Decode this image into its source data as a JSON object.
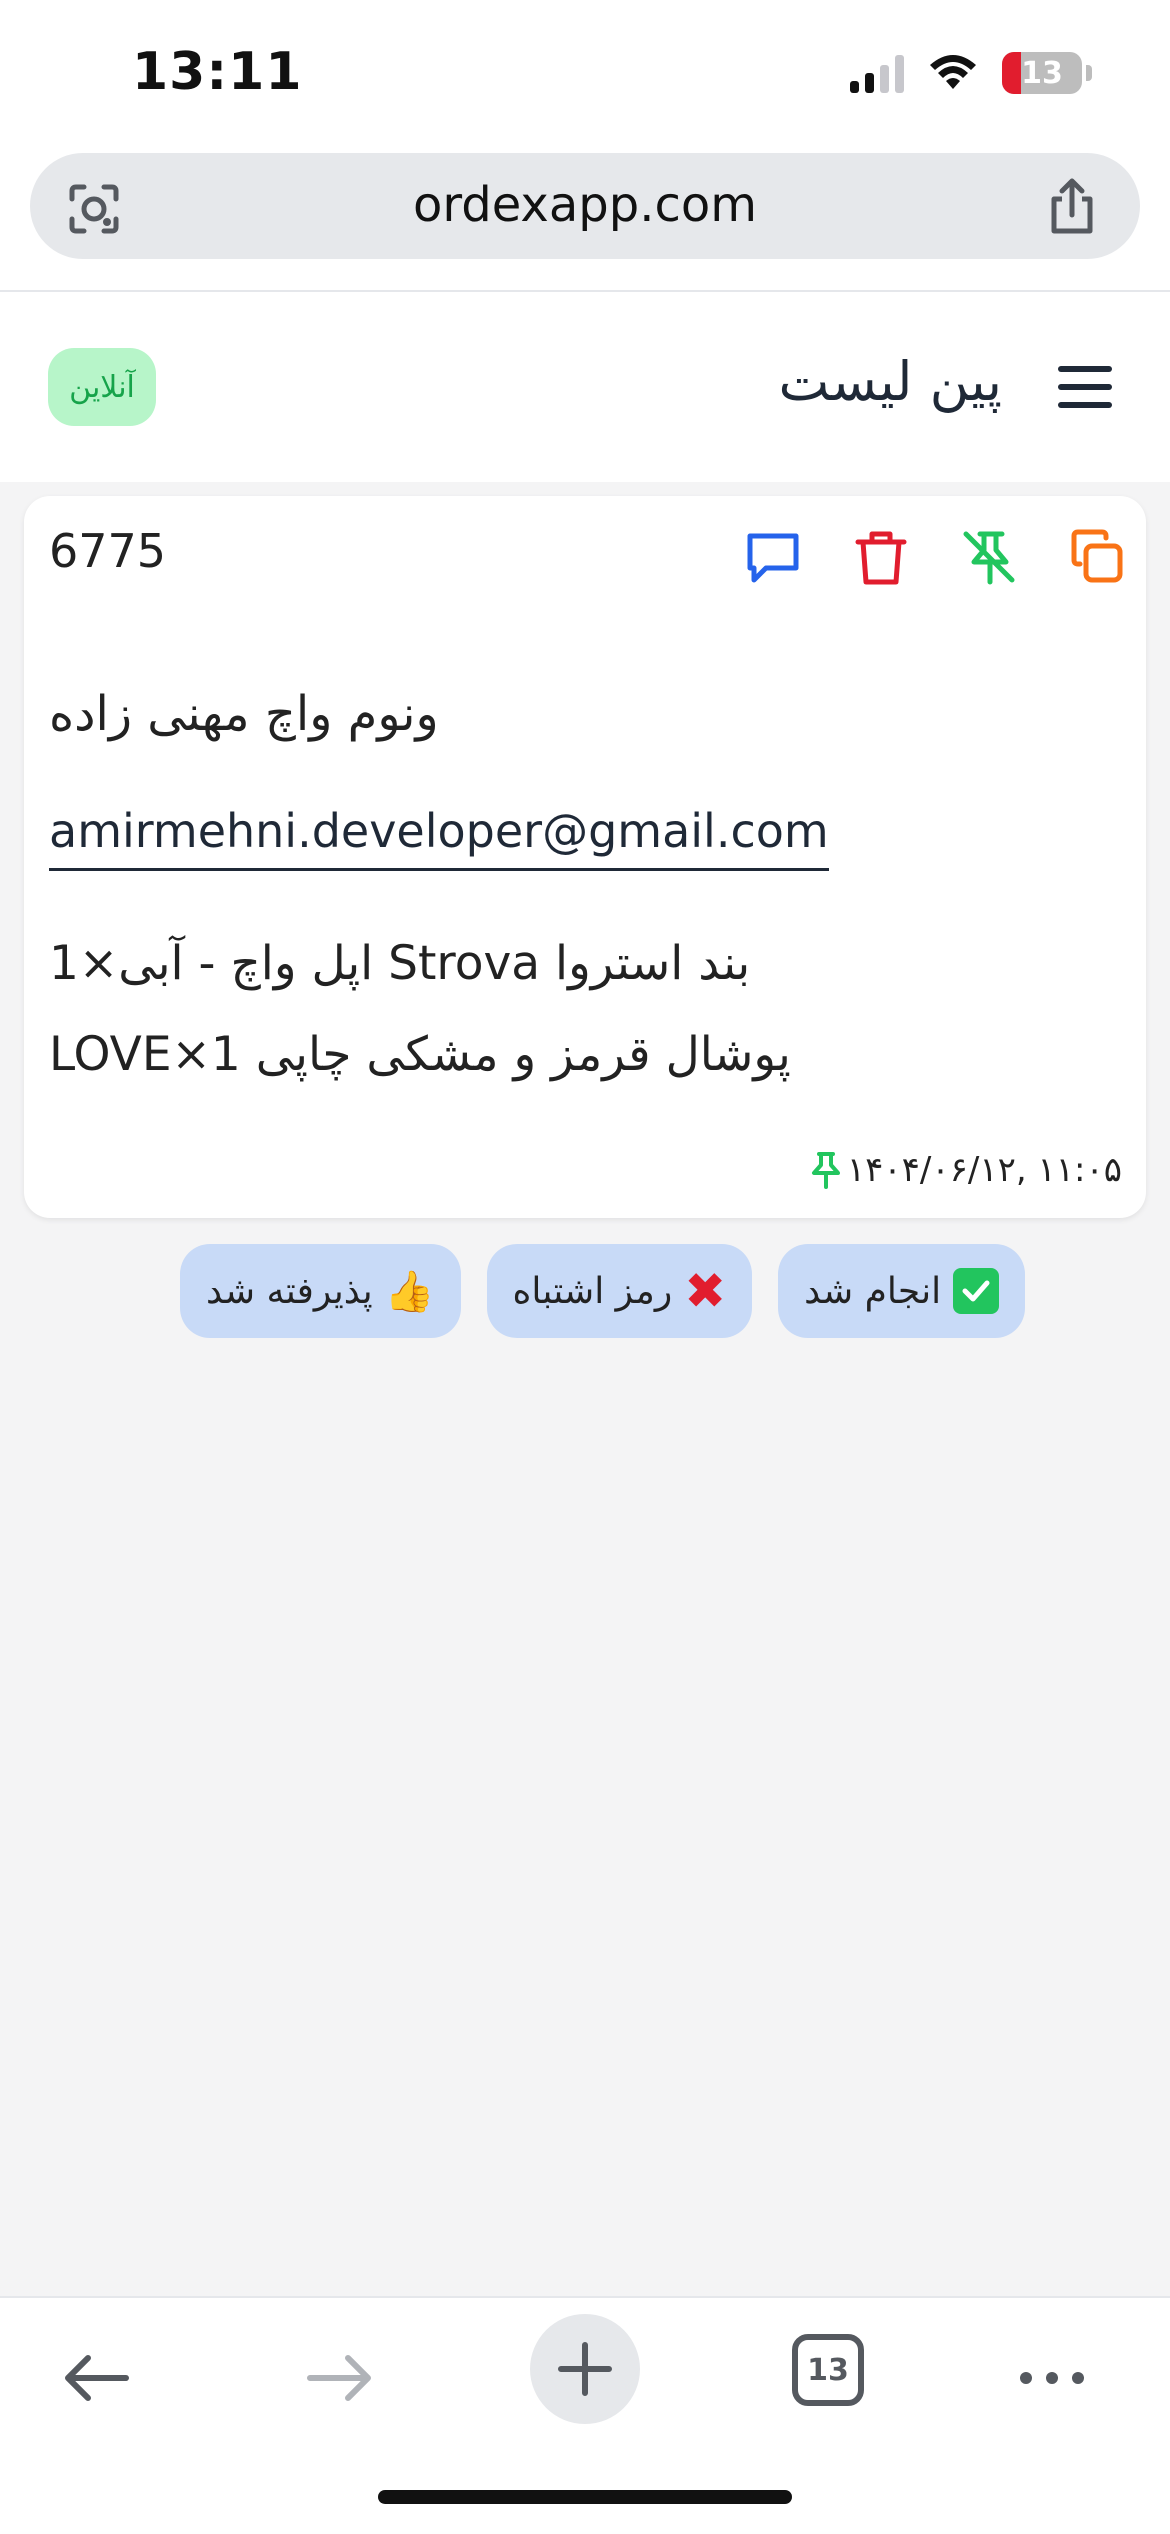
{
  "status_bar": {
    "time": "13:11",
    "battery": "13"
  },
  "browser": {
    "url": "ordexapp.com",
    "tabs_count": "13"
  },
  "header": {
    "title": "پین لیست",
    "status_badge": "آنلاین"
  },
  "order": {
    "id": "6775",
    "customer_name": "ونوم واچ مهنی زاده",
    "email": "amirmehni.developer@gmail.com",
    "items": [
      "بند استروا Strova اپل واچ - آبی×1",
      "پوشال قرمز و مشکی چاپی LOVE×1"
    ],
    "pinned_at": "۱۴۰۴/۰۶/۱۲, ۱۱:۰۵"
  },
  "quick_replies": [
    {
      "label": "انجام شد",
      "icon": "check-emoji"
    },
    {
      "label": "رمز اشتباه",
      "icon": "cross-emoji"
    },
    {
      "label": "پذیرفته شد",
      "icon": "thumbs-up-emoji"
    }
  ],
  "colors": {
    "online_bg": "#b7f5c9",
    "online_text": "#16a34a",
    "copy": "#f97316",
    "unpin": "#22c55e",
    "delete": "#e11d2e",
    "comment": "#2563eb",
    "chip_bg": "#c8daf7"
  }
}
